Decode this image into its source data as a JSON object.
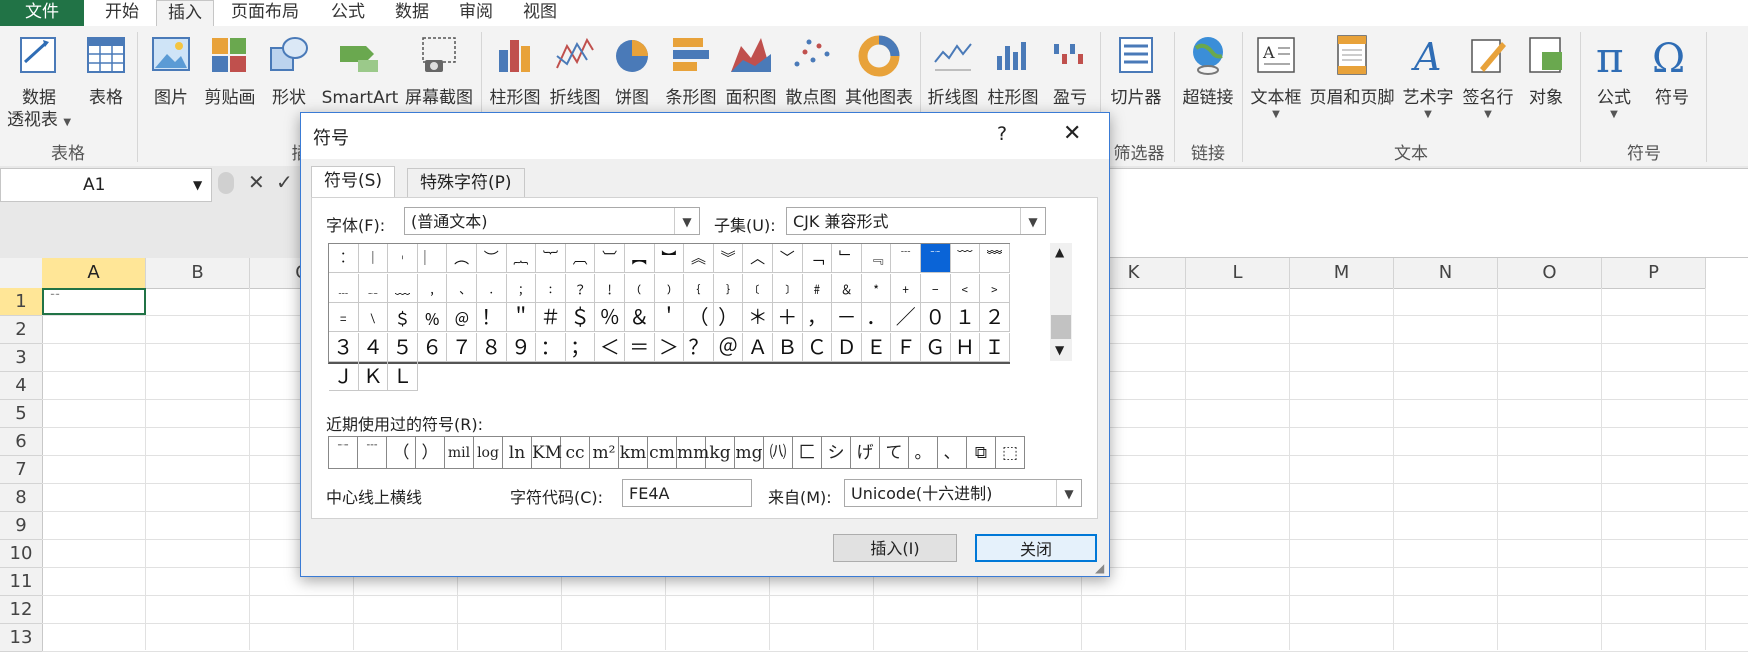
{
  "tabs": {
    "file": "文件",
    "home": "开始",
    "insert": "插入",
    "page_layout": "页面布局",
    "formulas": "公式",
    "data": "数据",
    "review": "审阅",
    "view": "视图"
  },
  "ribbon": {
    "pivot": "数据\n透视表",
    "pivot1": "数据",
    "pivot2": "透视表",
    "table": "表格",
    "picture": "图片",
    "clipart": "剪贴画",
    "shapes": "形状",
    "smartart": "SmartArt",
    "screenshot": "屏幕截图",
    "col_chart": "柱形图",
    "line_chart": "折线图",
    "pie_chart": "饼图",
    "bar_chart": "条形图",
    "area_chart": "面积图",
    "scatter_chart": "散点图",
    "other_chart": "其他图表",
    "spark_line": "折线图",
    "spark_col": "柱形图",
    "spark_wl": "盈亏",
    "slicer": "切片器",
    "hyperlink": "超链接",
    "textbox": "文本框",
    "header_footer": "页眉和页脚",
    "wordart": "艺术字",
    "signature": "签名行",
    "object": "对象",
    "equation": "公式",
    "symbol": "符号",
    "grp_tables": "表格",
    "grp_illus": "插",
    "grp_filter": "筛选器",
    "grp_links": "链接",
    "grp_text": "文本",
    "grp_symbols": "符号"
  },
  "formula_bar": {
    "name_box": "A1"
  },
  "grid": {
    "columns": [
      "A",
      "B",
      "C",
      "D",
      "E",
      "F",
      "G",
      "H",
      "I",
      "J",
      "K",
      "L",
      "M",
      "N",
      "O",
      "P"
    ],
    "rows": [
      "1",
      "2",
      "3",
      "4",
      "5",
      "6",
      "7",
      "8",
      "9",
      "10",
      "11",
      "12",
      "13"
    ],
    "a1_value": "﹊"
  },
  "dialog": {
    "title": "符号",
    "help": "?",
    "close_x": "✕",
    "tab_symbols": "符号(S)",
    "tab_special": "特殊字符(P)",
    "font_label": "字体(F):",
    "font_value": "(普通文本)",
    "subset_label": "子集(U):",
    "subset_value": "CJK 兼容形式",
    "symbols": [
      "︰",
      "︱",
      "︲",
      "︳",
      "︵",
      "︶",
      "︷",
      "︸",
      "︹",
      "︺",
      "︻",
      "︼",
      "︽",
      "︾",
      "︿",
      "﹀",
      "﹁",
      "﹂",
      "﹃",
      "﹉",
      "﹊",
      "﹋",
      "﹌",
      "﹍",
      "﹎",
      "﹏",
      "﹐",
      "﹑",
      "﹒",
      "﹔",
      "﹕",
      "﹖",
      "﹗",
      "﹙",
      "﹚",
      "﹛",
      "﹜",
      "﹝",
      "﹞",
      "﹟",
      "﹠",
      "﹡",
      "﹢",
      "﹣",
      "﹤",
      "﹥",
      "﹦",
      "﹨",
      "﹩",
      "﹪",
      "﹫",
      "！",
      "＂",
      "＃",
      "＄",
      "％",
      "＆",
      "＇",
      "（",
      "）",
      "＊",
      "＋",
      "，",
      "－",
      "．",
      "／",
      "０",
      "１",
      "２",
      "３",
      "４",
      "５",
      "６",
      "７",
      "８",
      "９",
      "：",
      "；",
      "＜",
      "＝",
      "＞",
      "？",
      "＠",
      "Ａ",
      "Ｂ",
      "Ｃ",
      "Ｄ",
      "Ｅ",
      "Ｆ",
      "Ｇ",
      "Ｈ",
      "Ｉ",
      "Ｊ",
      "Ｋ",
      "Ｌ"
    ],
    "selected_index": 20,
    "recent_label": "近期使用过的符号(R):",
    "recent": [
      "﹊",
      "﹉",
      "（",
      "）",
      "mil",
      "log",
      "ln",
      "KM",
      "cc",
      "m²",
      "km",
      "cm",
      "mm",
      "kg",
      "mg",
      "㈧",
      "匚",
      "シ",
      "げ",
      "て",
      "。",
      "、",
      "⧉",
      "⬚"
    ],
    "char_name": "中心线上横线",
    "code_label": "字符代码(C):",
    "code_value": "FE4A",
    "from_label": "来自(M):",
    "from_value": "Unicode(十六进制)",
    "insert_btn": "插入(I)",
    "close_btn": "关闭"
  }
}
